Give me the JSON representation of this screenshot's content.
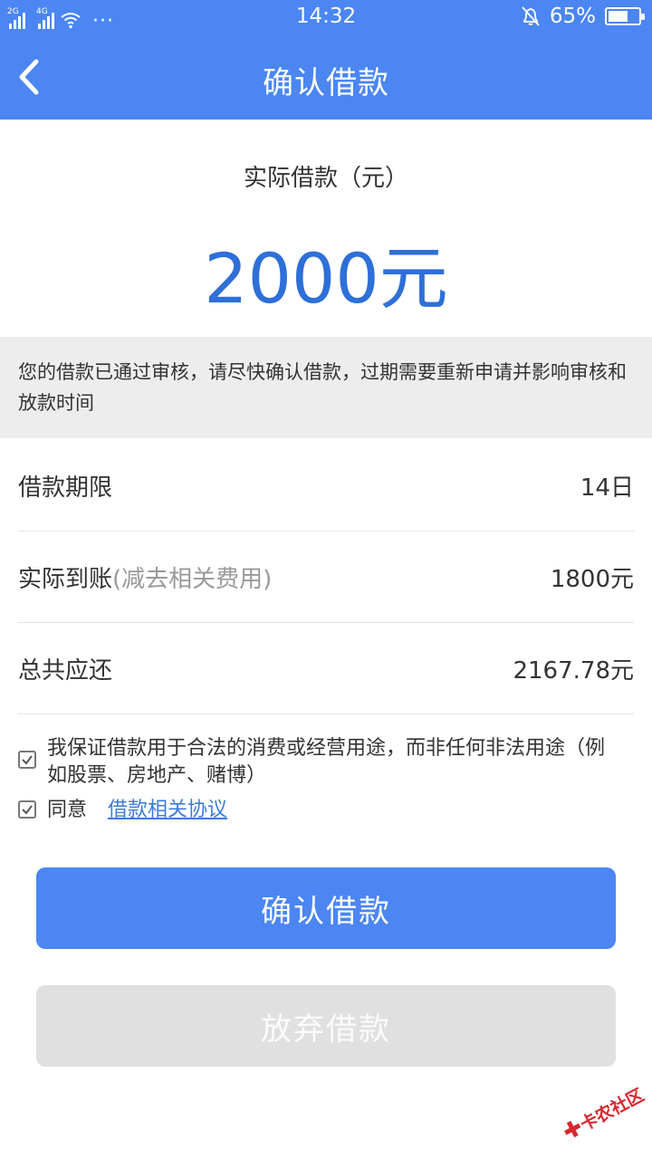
{
  "status_bar": {
    "signal1_label": "2G",
    "signal2_label": "4G",
    "dots": "···",
    "time": "14:32",
    "battery": "65%",
    "battery_level": 0.65
  },
  "nav": {
    "title": "确认借款"
  },
  "amount": {
    "label": "实际借款（元）",
    "value": "2000元"
  },
  "notice": "您的借款已通过审核，请尽快确认借款，过期需要重新申请并影响审核和放款时间",
  "details": [
    {
      "label": "借款期限",
      "note": "",
      "value": "14日"
    },
    {
      "label": "实际到账",
      "note": "(减去相关费用)",
      "value": "1800元"
    },
    {
      "label": "总共应还",
      "note": "",
      "value": "2167.78元"
    }
  ],
  "agreements": {
    "guarantee_text": "我保证借款用于合法的消费或经营用途，而非任何非法用途（例如股票、房地产、赌博）",
    "agree_text": "同意",
    "agree_link": "借款相关协议"
  },
  "buttons": {
    "confirm": "确认借款",
    "give_up": "放弃借款"
  },
  "watermark": "卡农社区",
  "colors": {
    "primary": "#4b86f3",
    "amount": "#2e6fd8",
    "link": "#3c7bd9",
    "watermark": "#d9262c"
  }
}
